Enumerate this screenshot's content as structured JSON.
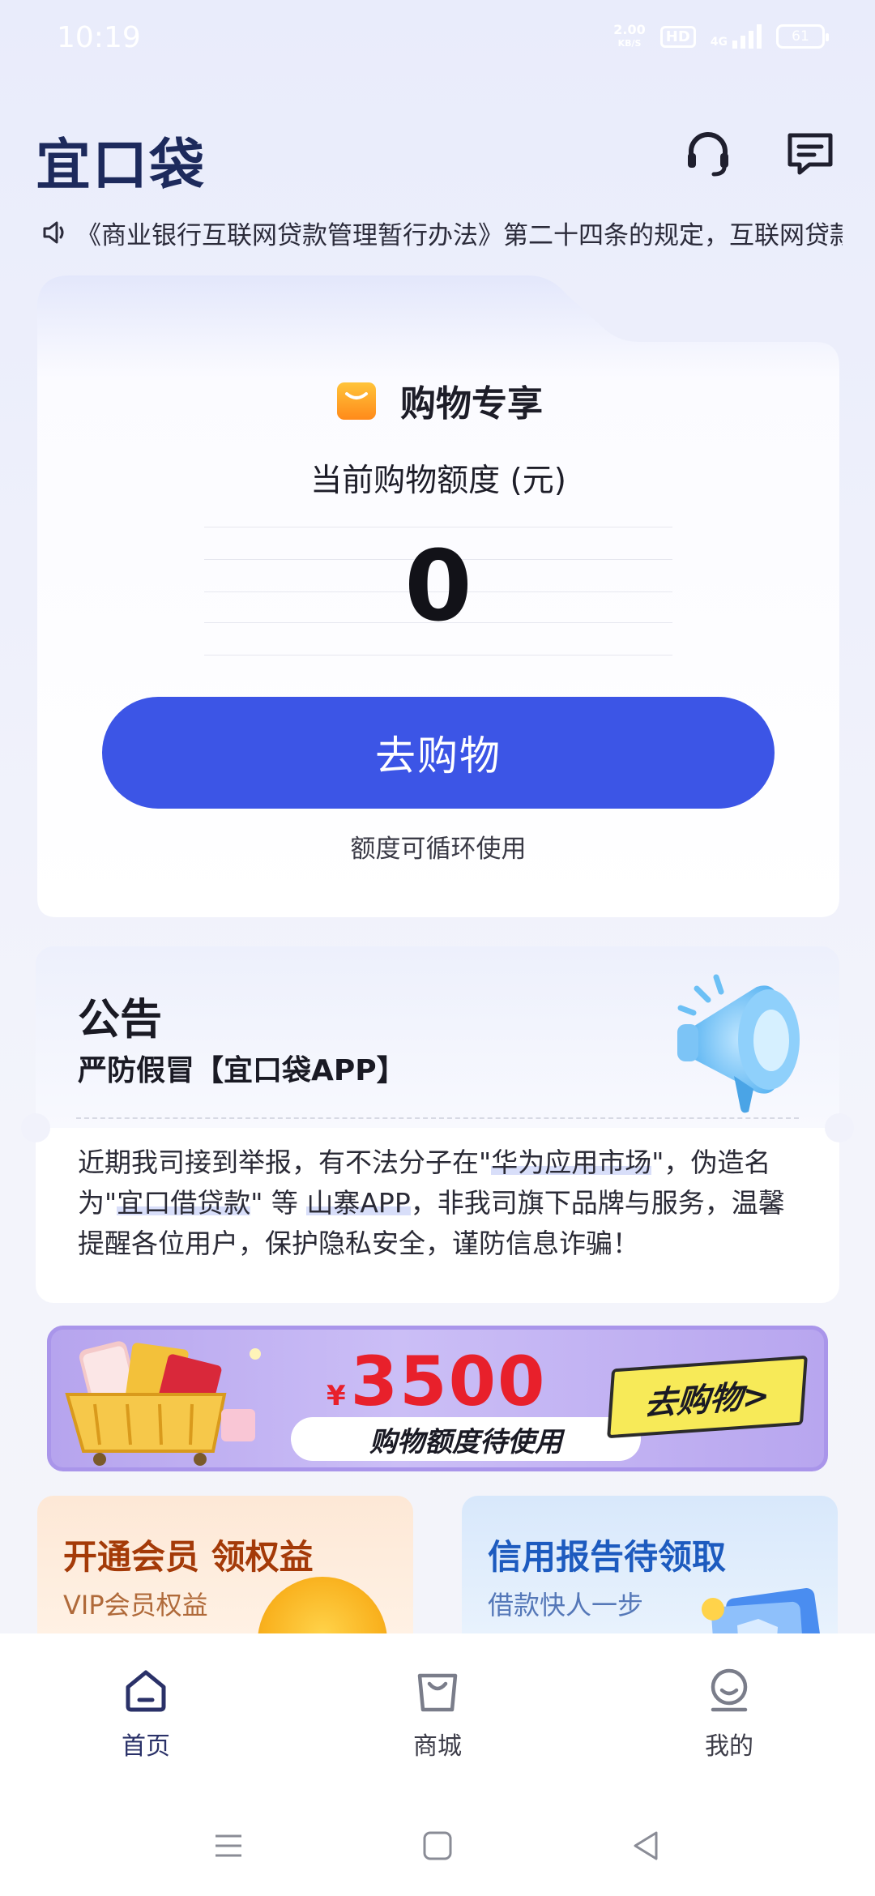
{
  "status_bar": {
    "time": "10:19",
    "net_speed_value": "2.00",
    "net_speed_unit": "KB/S",
    "hd": "HD",
    "network": "4G",
    "battery": "61"
  },
  "header": {
    "logo": "宜口袋",
    "icons": [
      "headset-icon",
      "message-icon"
    ]
  },
  "notice": {
    "text": "《商业银行互联网贷款管理暂行办法》第二十四条的规定，互联网贷款"
  },
  "shopping_card": {
    "title": "购物专享",
    "quota_label": "当前购物额度 (元)",
    "quota_value": "0",
    "button_label": "去购物",
    "note": "额度可循环使用"
  },
  "announcement": {
    "title": "公告",
    "subtitle": "严防假冒【宜口袋APP】",
    "body_1": "近期我司接到举报，有不法分子在\"",
    "hl_1": "华为应用市场",
    "body_2": "\"，伪造名为\"",
    "hl_2": "宜口借贷款",
    "body_3": "\" 等 ",
    "hl_3": "山寨APP",
    "body_4": "，非我司旗下品牌与服务，温馨提醒各位用户，保护隐私安全，谨防信息诈骗！"
  },
  "promo_banner": {
    "currency": "¥",
    "amount": "3500",
    "caption": "购物额度待使用",
    "cta": "去购物>"
  },
  "tiles": {
    "vip": {
      "title": "开通会员 领权益",
      "subtitle": "VIP会员权益"
    },
    "credit": {
      "title": "信用报告待领取",
      "subtitle": "借款快人一步"
    }
  },
  "bottom_nav": {
    "home": "首页",
    "mall": "商城",
    "mine": "我的",
    "active": "home",
    "active_color": "#2a3168"
  },
  "colors": {
    "primary_button": "#3c55e6",
    "promo_amount": "#e8202b",
    "promo_cta_bg": "#f7ea58"
  }
}
